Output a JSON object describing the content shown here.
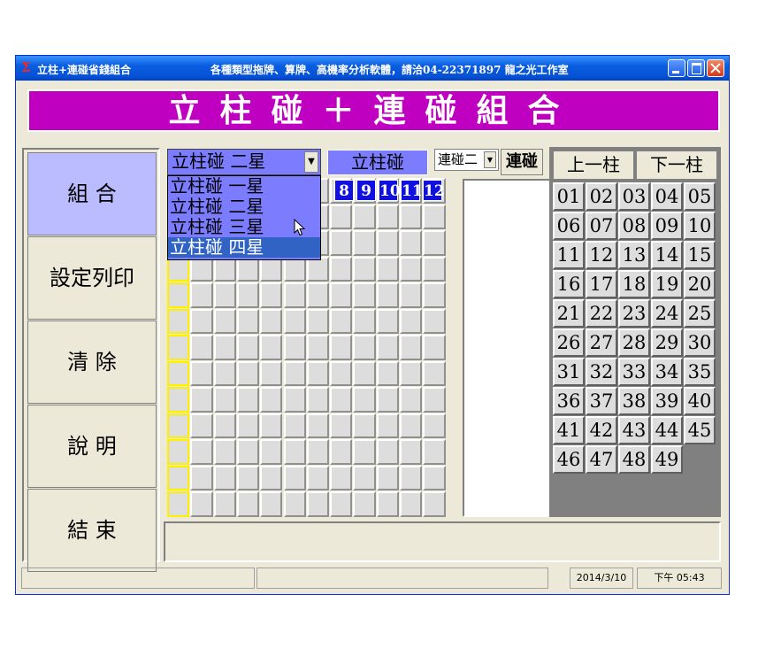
{
  "window": {
    "app_icon": "Σ",
    "title": "立柱+連碰省錢組合",
    "subtitle": "各種類型拖牌、算牌、高機率分析軟體，請洽04-22371897 龍之光工作室"
  },
  "banner": {
    "text": "立柱碰＋連碰組合"
  },
  "sidebar": {
    "items": [
      {
        "label": "組 合"
      },
      {
        "label": "設定列印"
      },
      {
        "label": "清 除"
      },
      {
        "label": "說 明"
      },
      {
        "label": "結 束"
      }
    ]
  },
  "center": {
    "type_select": {
      "value": "立柱碰 二星"
    },
    "dropdown": {
      "options": [
        "立柱碰 一星",
        "立柱碰 二星",
        "立柱碰 三星",
        "立柱碰 四星"
      ],
      "highlighted": 3
    },
    "mode_label": "立柱碰",
    "lianpeng_select": {
      "value": "連碰二"
    },
    "lianpeng_button": "連碰",
    "column_headers": [
      "8",
      "9",
      "10",
      "11",
      "12"
    ]
  },
  "right": {
    "prev_button": "上一柱",
    "next_button": "下一柱",
    "numbers": [
      "01",
      "02",
      "03",
      "04",
      "05",
      "06",
      "07",
      "08",
      "09",
      "10",
      "11",
      "12",
      "13",
      "14",
      "15",
      "16",
      "17",
      "18",
      "19",
      "20",
      "21",
      "22",
      "23",
      "24",
      "25",
      "26",
      "27",
      "28",
      "29",
      "30",
      "31",
      "32",
      "33",
      "34",
      "35",
      "36",
      "37",
      "38",
      "39",
      "40",
      "41",
      "42",
      "43",
      "44",
      "45",
      "46",
      "47",
      "48",
      "49"
    ]
  },
  "statusbar": {
    "date": "2014/3/10",
    "time": "下午 05:43"
  },
  "icons": {
    "app": "sigma-icon",
    "minimize": "minimize-icon",
    "maximize": "maximize-icon",
    "close": "close-icon",
    "dropdown": "chevron-down-icon",
    "cursor": "mouse-pointer-icon"
  },
  "colors": {
    "banner": "#C000C0",
    "accent": "#7C7CFF",
    "header_num": "#1010E0",
    "highlight": "#3163C5"
  }
}
